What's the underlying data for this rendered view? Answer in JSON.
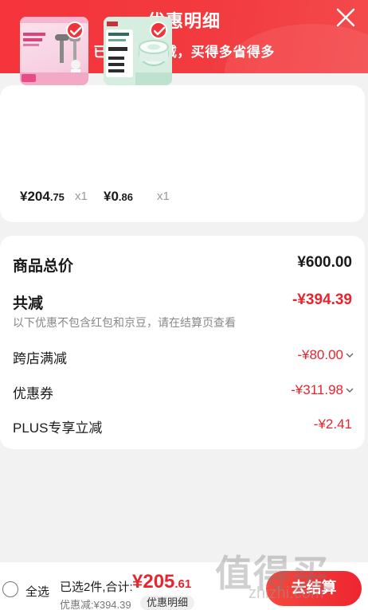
{
  "header": {
    "title": "优惠明细",
    "subtitle": "已享跨店满减，买得多省得多"
  },
  "products": [
    {
      "price_int": "¥204",
      "price_dec": ".75",
      "qty": "x1"
    },
    {
      "price_int": "¥0",
      "price_dec": ".86",
      "qty": "x1"
    }
  ],
  "summary": {
    "total_label": "商品总价",
    "total_value": "¥600.00",
    "reduce_label": "共减",
    "reduce_value": "-¥394.39",
    "note": "以下优惠不包含红包和京豆，请在结算页查看",
    "items": [
      {
        "label": "跨店满减",
        "value": "-¥80.00"
      },
      {
        "label": "优惠券",
        "value": "-¥311.98"
      },
      {
        "label": "PLUS专享立减",
        "value": "-¥2.41"
      }
    ]
  },
  "bottom": {
    "select_all": "全选",
    "selected_text": "已选2件,合计:",
    "total_int": "¥205",
    "total_dec": ".61",
    "discount_text": "优惠减:¥394.39",
    "detail_button": "优惠明细",
    "checkout_button": "去结算",
    "watermark": "值得买",
    "watermark_sub": "zhizhi.com"
  },
  "colors": {
    "accent": "#f0343a",
    "discount_red": "#e8242d"
  }
}
